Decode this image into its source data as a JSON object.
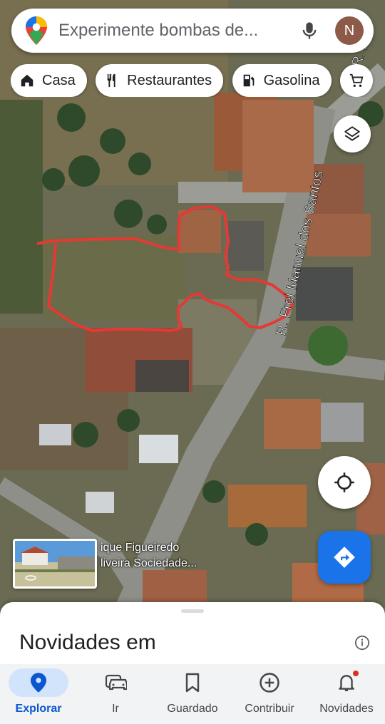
{
  "search": {
    "placeholder": "Experimente bombas de..."
  },
  "user": {
    "avatar_initial": "N",
    "avatar_color": "#8d5a4a"
  },
  "chips": [
    {
      "icon": "home-icon",
      "label": "Casa"
    },
    {
      "icon": "restaurant-icon",
      "label": "Restaurantes"
    },
    {
      "icon": "gas-station-icon",
      "label": "Gasolina"
    },
    {
      "icon": "cart-icon",
      "label": ""
    }
  ],
  "map": {
    "street_name": "R. Frei Manuel dos Santos",
    "street_name_top": "R. M",
    "place_label_line1": "ique Figueiredo",
    "place_label_line2": "liveira Sociedade...",
    "outline_color": "#e53935"
  },
  "sheet": {
    "title": "Novidades em"
  },
  "nav": {
    "items": [
      {
        "icon": "explore-pin-icon",
        "label": "Explorar",
        "active": true
      },
      {
        "icon": "car-icon",
        "label": "Ir",
        "active": false
      },
      {
        "icon": "bookmark-icon",
        "label": "Guardado",
        "active": false
      },
      {
        "icon": "add-circle-icon",
        "label": "Contribuir",
        "active": false
      },
      {
        "icon": "bell-icon",
        "label": "Novidades",
        "active": false,
        "badge": true
      }
    ]
  },
  "colors": {
    "accent": "#1a73e8",
    "active_nav": "#0b57d0",
    "badge": "#d93025"
  }
}
